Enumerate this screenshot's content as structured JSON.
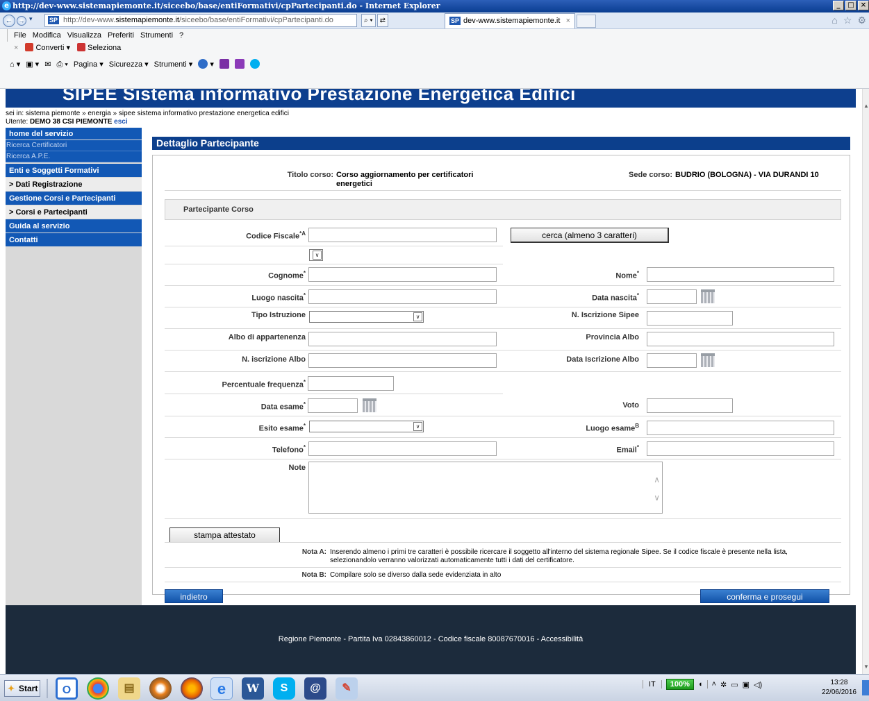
{
  "window": {
    "title": "http://dev-www.sistemapiemonte.it/siceebo/base/entiFormativi/cpPartecipanti.do - Internet Explorer",
    "controls": [
      "_",
      "□",
      "×"
    ]
  },
  "address": {
    "prefix": "http://dev-www.",
    "host": "sistemapiemonte.it",
    "path": "/siceebo/base/entiFormativi/cpPartecipanti.do",
    "search_glyph": "⌕ ▾",
    "compat_glyph": "⇄",
    "site_badge": "SP"
  },
  "tab": {
    "label": "dev-www.sistemapiemonte.it",
    "close": "×"
  },
  "menubar": [
    "File",
    "Modifica",
    "Visualizza",
    "Preferiti",
    "Strumenti",
    "?"
  ],
  "favbar": {
    "close": "×",
    "items": [
      "Converti",
      "Seleziona"
    ]
  },
  "cmdbar": [
    "Pagina",
    "Sicurezza",
    "Strumenti"
  ],
  "page": {
    "banner": "SIPEE Sistema informativo Prestazione Energetica Edifici",
    "breadcrumb": "sei in: sistema piemonte » energia »  sipee sistema informativo prestazione energetica edifici",
    "user_prefix": "Utente: ",
    "user_name": "DEMO 38 CSI PIEMONTE",
    "logout": "esci"
  },
  "sidebar": {
    "home": "home del servizio",
    "ricerca_cert": "Ricerca Certificatori",
    "ricerca_ape": "Ricerca A.P.E.",
    "enti": "Enti e Soggetti Formativi",
    "dati": "> Dati Registrazione",
    "gestione": "Gestione Corsi e Partecipanti",
    "corsi": "> Corsi e Partecipanti",
    "guida": "Guida al servizio",
    "contatti": "Contatti"
  },
  "form": {
    "heading": "Dettaglio Partecipante",
    "titolo_label": "Titolo corso:",
    "titolo_value": "Corso aggiornamento per certificatori energetici",
    "sede_label": "Sede corso:",
    "sede_value": "BUDRIO (BOLOGNA) - VIA DURANDI 10",
    "section": "Partecipante Corso",
    "cf_label": "Codice Fiscale",
    "cf_sup": "*A",
    "cerca_btn": "cerca (almeno 3 caratteri)",
    "req": "*",
    "cognome": "Cognome",
    "nome": "Nome",
    "luogo_nascita": "Luogo nascita",
    "data_nascita": "Data nascita",
    "tipo_istruzione": "Tipo Istruzione",
    "n_iscr_sipee": "N. Iscrizione Sipee",
    "albo": "Albo di appartenenza",
    "provincia_albo": "Provincia Albo",
    "n_iscr_albo": "N. iscrizione Albo",
    "data_iscr_albo": "Data Iscrizione Albo",
    "perc_freq": "Percentuale frequenza",
    "data_esame": "Data esame",
    "voto": "Voto",
    "esito_esame": "Esito esame",
    "luogo_esame": "Luogo esame",
    "luogo_esame_sup": "B",
    "telefono": "Telefono",
    "email": "Email",
    "note": "Note",
    "stampa_btn": "stampa attestato",
    "nota_a_label": "Nota A:",
    "nota_a_text": "Inserendo almeno i primi tre caratteri è possibile ricercare il soggetto all'interno del sistema regionale Sipee. Se il codice fiscale è presente nella lista, selezionandolo verranno valorizzati automaticamente tutti i dati del certificatore.",
    "nota_b_label": "Nota B:",
    "nota_b_text": "Compilare solo se diverso dalla sede evidenziata in alto",
    "indietro_btn": "indietro",
    "conferma_btn": "conferma e prosegui",
    "dropdown_glyph": "∨",
    "scroll_up": "∧",
    "scroll_down": "∨"
  },
  "footer": "Regione Piemonte - Partita Iva 02843860012 - Codice fiscale 80087670016 - Accessibilità",
  "taskbar": {
    "start": "Start",
    "lang": "IT",
    "battery": "100%",
    "time": "13:28",
    "date": "22/06/2016"
  }
}
